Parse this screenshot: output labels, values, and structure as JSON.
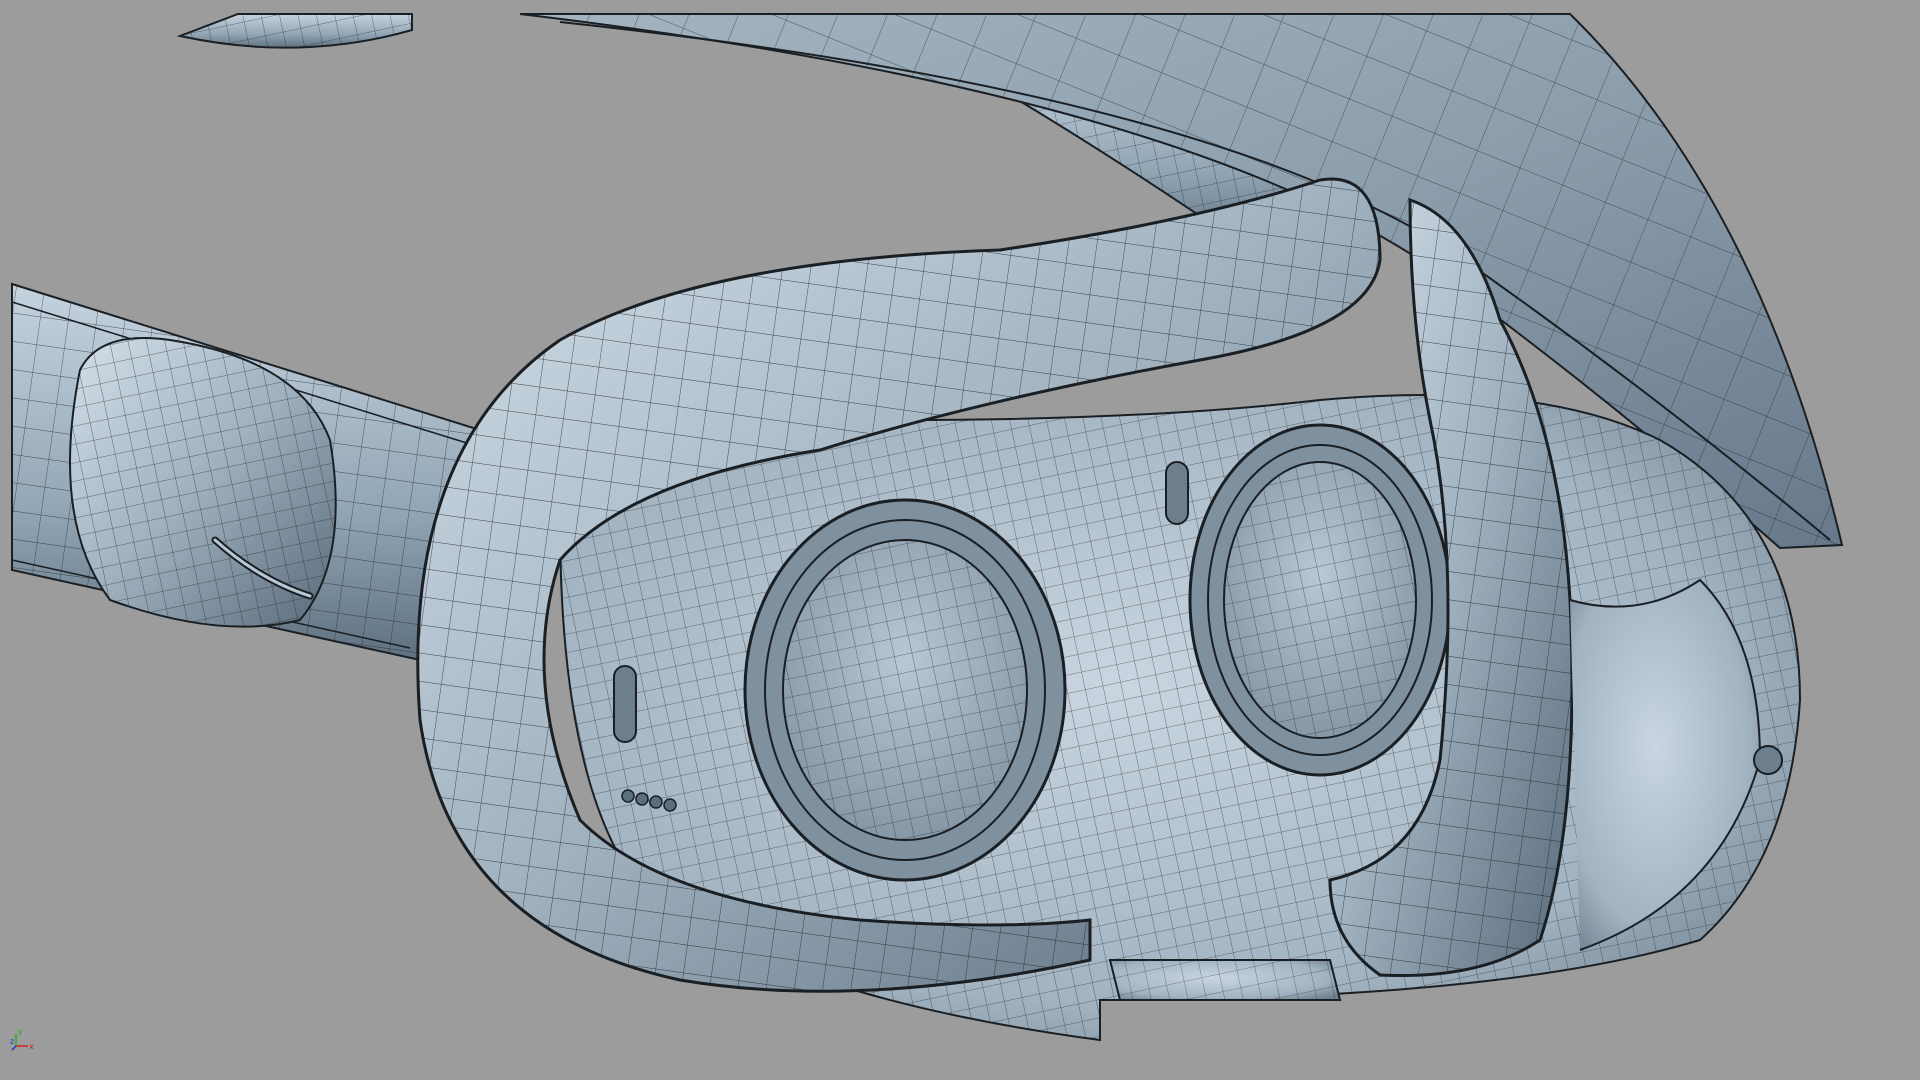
{
  "viewport": {
    "background_color": "#9c9c9c",
    "surface_color": "#a9b9c6",
    "surface_dark_color": "#6c7e8c",
    "wire_color": "#1a1f24"
  },
  "scene": {
    "model_description_icon": "vr-headset-wireframe-model"
  },
  "axis_gizmo": {
    "x_label": "x",
    "y_label": "y",
    "z_label": "z",
    "x_color": "#d02020",
    "y_color": "#20b020",
    "z_color": "#2030d0"
  }
}
